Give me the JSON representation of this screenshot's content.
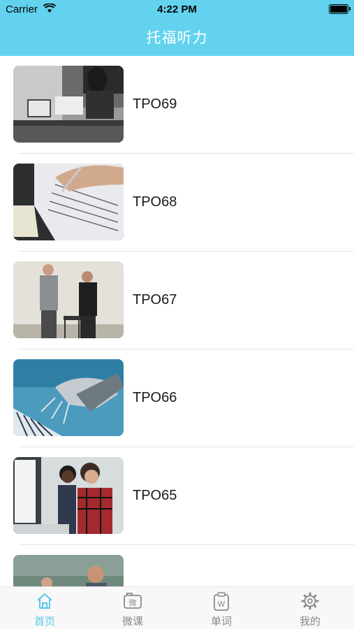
{
  "status_bar": {
    "carrier": "Carrier",
    "time": "4:22 PM"
  },
  "header": {
    "title": "托福听力"
  },
  "list": {
    "items": [
      {
        "label": "TPO69",
        "image": "office-workers-photo"
      },
      {
        "label": "TPO68",
        "image": "exam-answer-sheet-photo"
      },
      {
        "label": "TPO67",
        "image": "two-men-talking-photo"
      },
      {
        "label": "TPO66",
        "image": "robot-hands-keyboard-photo"
      },
      {
        "label": "TPO65",
        "image": "students-at-computer-photo"
      },
      {
        "label": "",
        "image": "classroom-people-photo"
      }
    ]
  },
  "tabbar": {
    "tabs": [
      {
        "label": "首页",
        "icon": "home-icon",
        "active": true
      },
      {
        "label": "微课",
        "icon": "micro-lesson-icon",
        "active": false
      },
      {
        "label": "单词",
        "icon": "words-icon",
        "active": false
      },
      {
        "label": "我的",
        "icon": "gear-icon",
        "active": false
      }
    ]
  },
  "colors": {
    "accent": "#62d2ee",
    "active_tab": "#57c8ea",
    "inactive_tab": "#8a8a8a"
  }
}
